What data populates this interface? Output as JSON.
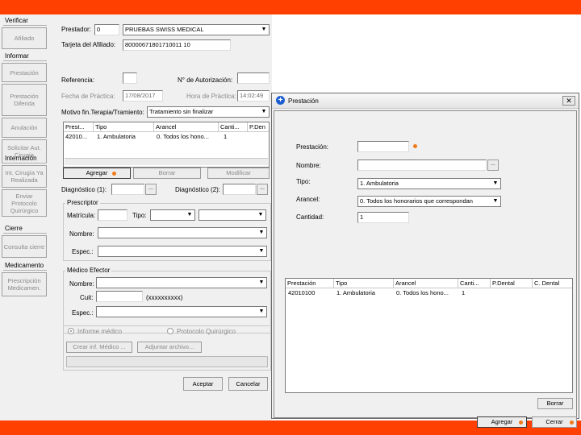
{
  "sidebar": {
    "verificar": {
      "title": "Verificar",
      "afiliado": "Afiliado"
    },
    "informar": {
      "title": "Informar",
      "prestacion": "Prestación",
      "prestacion_diferida": "Prestación Diferida",
      "anulacion": "Anulación",
      "solicitar": "Solicitar Aut. Cirugía"
    },
    "internacion": {
      "title": "Internación",
      "int_cirugia": "Int. Cirugía Ya Realizada",
      "enviar_protocolo": "Enviar Protocolo Quirúrgico"
    },
    "cierre": {
      "title": "Cierre",
      "consulta": "Consulta cierre"
    },
    "medicamento": {
      "title": "Medicamento",
      "prescripcion": "Prescripción Medicamen."
    }
  },
  "form": {
    "prestador_label": "Prestador:",
    "prestador_code": "0",
    "prestador_name": "PRUEBAS SWISS MEDICAL",
    "tarjeta_label": "Tarjeta del Afiliado:",
    "tarjeta_value": "80000671801710011 10",
    "referencia_label": "Referencia:",
    "autorizacion_label": "N° de Autorización:",
    "fecha_label": "Fecha de Práctica:",
    "fecha_value": "17/08/2017",
    "hora_label": "Hora de Práctica:",
    "hora_value": "14:02:49",
    "motivo_label": "Motivo fin.Terapia/Tramiento:",
    "motivo_value": "Tratamiento sin finalizar",
    "grid_headers": [
      "Prest...",
      "Tipo",
      "Arancel",
      "Canti...",
      "P.Den"
    ],
    "grid_row": [
      "42010...",
      "1. Ambulatoria",
      "0. Todos los hono...",
      "1",
      ""
    ],
    "agregar": "Agregar",
    "borrar": "Borrar",
    "modificar": "Modificar",
    "diag1_label": "Diagnóstico (1):",
    "diag2_label": "Diagnóstico (2):",
    "prescriptor_title": "Prescriptor",
    "matricula_label": "Matrícula:",
    "tipo_label": "Tipo:",
    "nombre_label": "Nombre:",
    "espec_label": "Espec.:",
    "efector_title": "Médico Efector",
    "cuit_label": "Cuit:",
    "cuit_hint": "(xxxxxxxxxx)",
    "radio_informe": "Informe médico",
    "radio_protocolo": "Protocolo Quirúrgico",
    "crear_informe": "Crear inf. Médico ...",
    "adjuntar": "Adjuntar archivo...",
    "aceptar": "Aceptar",
    "cancelar": "Cancelar",
    "ellipsis": "..."
  },
  "dialog": {
    "title": "Prestación",
    "prestacion_label": "Prestación:",
    "nombre_label": "Nombre:",
    "tipo_label": "Tipo:",
    "tipo_value": "1. Ambulatoria",
    "arancel_label": "Arancel:",
    "arancel_value": "0. Todos los honorarios que correspondan",
    "cantidad_label": "Cantidad:",
    "cantidad_value": "1",
    "grid_headers": [
      "Prestación",
      "Tipo",
      "Arancel",
      "Canti...",
      "P.Dental",
      "C. Dental"
    ],
    "grid_row": [
      "42010100",
      "1. Ambulatoria",
      "0. Todos los hono...",
      "1",
      "",
      ""
    ],
    "borrar": "Borrar",
    "agregar": "Agregar",
    "cerrar": "Cerrar",
    "ellipsis": "..."
  },
  "colors": {
    "frame": "#ff4000",
    "accent_dot": "#f07a1a",
    "title_icon": "#1e5fd0"
  }
}
